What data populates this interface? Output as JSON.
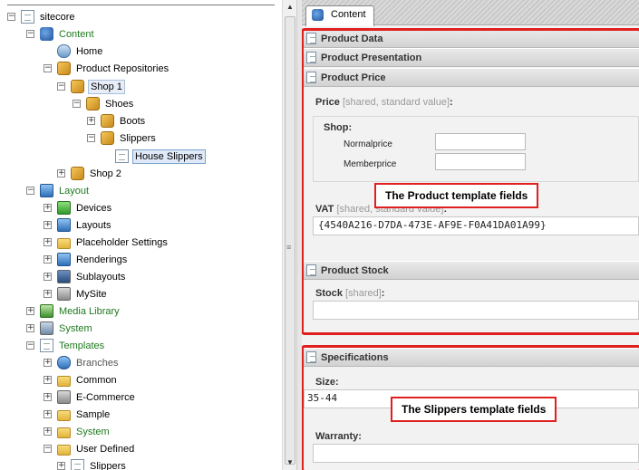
{
  "tree": {
    "nodes": [
      {
        "label": "sitecore",
        "toggle": "−",
        "icon": "page-icon",
        "color": "default"
      },
      {
        "label": "Content",
        "toggle": "−",
        "icon": "content-icon",
        "color": "green"
      },
      {
        "label": "Home",
        "toggle": "",
        "icon": "home-icon",
        "color": "default"
      },
      {
        "label": "Product Repositories",
        "toggle": "−",
        "icon": "box-icon",
        "color": "default"
      },
      {
        "label": "Shop 1",
        "toggle": "−",
        "icon": "box-icon",
        "color": "default"
      },
      {
        "label": "Shoes",
        "toggle": "−",
        "icon": "box-icon",
        "color": "default"
      },
      {
        "label": "Boots",
        "toggle": "+",
        "icon": "box-icon",
        "color": "default"
      },
      {
        "label": "Slippers",
        "toggle": "−",
        "icon": "box-icon",
        "color": "default"
      },
      {
        "label": "House Slippers",
        "toggle": "",
        "icon": "page-icon",
        "color": "default",
        "selected": true
      },
      {
        "label": "Shop 2",
        "toggle": "+",
        "icon": "box-icon",
        "color": "default"
      },
      {
        "label": "Layout",
        "toggle": "−",
        "icon": "layout-icon",
        "color": "green"
      },
      {
        "label": "Devices",
        "toggle": "+",
        "icon": "device-icon",
        "color": "default"
      },
      {
        "label": "Layouts",
        "toggle": "+",
        "icon": "layout-icon",
        "color": "default"
      },
      {
        "label": "Placeholder Settings",
        "toggle": "+",
        "icon": "folder-icon",
        "color": "default"
      },
      {
        "label": "Renderings",
        "toggle": "+",
        "icon": "rendering-icon",
        "color": "default"
      },
      {
        "label": "Sublayouts",
        "toggle": "+",
        "icon": "sublayout-icon",
        "color": "default"
      },
      {
        "label": "MySite",
        "toggle": "+",
        "icon": "site-icon",
        "color": "default"
      },
      {
        "label": "Media Library",
        "toggle": "+",
        "icon": "media-icon",
        "color": "green"
      },
      {
        "label": "System",
        "toggle": "+",
        "icon": "system-icon",
        "color": "green"
      },
      {
        "label": "Templates",
        "toggle": "−",
        "icon": "template-icon",
        "color": "green"
      },
      {
        "label": "Branches",
        "toggle": "+",
        "icon": "branch-icon",
        "color": "gray"
      },
      {
        "label": "Common",
        "toggle": "+",
        "icon": "folder-icon",
        "color": "default"
      },
      {
        "label": "E-Commerce",
        "toggle": "+",
        "icon": "ecommerce-icon",
        "color": "default"
      },
      {
        "label": "Sample",
        "toggle": "+",
        "icon": "folder-icon",
        "color": "default"
      },
      {
        "label": "System",
        "toggle": "+",
        "icon": "folder-icon",
        "color": "green"
      },
      {
        "label": "User Defined",
        "toggle": "−",
        "icon": "folder-icon",
        "color": "default"
      },
      {
        "label": "Slippers",
        "toggle": "+",
        "icon": "template-icon",
        "color": "default"
      }
    ]
  },
  "splitter": {
    "grip": "≡"
  },
  "scrollbar": {
    "up": "▲",
    "down": "▼"
  },
  "editor": {
    "tab_label": "Content",
    "sections": {
      "product_data": "Product Data",
      "product_presentation": "Product Presentation",
      "product_price": "Product Price",
      "product_stock": "Product Stock",
      "specifications": "Specifications"
    },
    "price": {
      "label": "Price",
      "meta": "[shared, standard value]",
      "suffix": ":"
    },
    "shop": {
      "label": "Shop:",
      "normal_label": "Normalprice",
      "member_label": "Memberprice",
      "normal_value": "",
      "member_value": ""
    },
    "vat": {
      "label": "VAT",
      "meta": "[shared, standard value]",
      "suffix": ":",
      "value": "{4540A216-D7DA-473E-AF9E-F0A41DA01A99}"
    },
    "stock": {
      "label": "Stock",
      "meta": "[shared]",
      "suffix": ":",
      "value": ""
    },
    "size": {
      "label": "Size:",
      "value": "35-44"
    },
    "warranty": {
      "label": "Warranty:",
      "value": ""
    },
    "callouts": {
      "product": "The Product template fields",
      "slippers": "The Slippers template fields"
    },
    "colors": {
      "annotation": "#e01f1f",
      "tree_green": "#1e7a1e"
    }
  }
}
